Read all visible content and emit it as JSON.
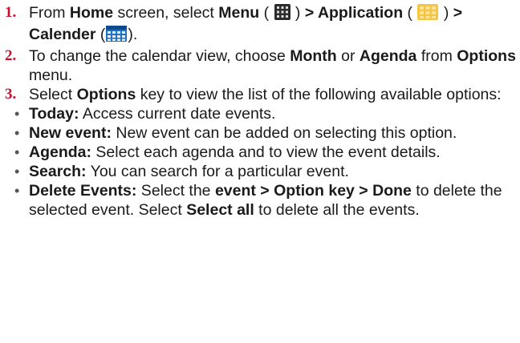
{
  "steps": [
    {
      "number": "1.",
      "parts": {
        "t1": "From ",
        "b1": "Home",
        "t2": " screen, select ",
        "b2": "Menu",
        "t3": " ( ",
        "t4": " ) ",
        "b3": "> Application",
        "t5": " ( ",
        "t6": " ) ",
        "b4": "> Calender",
        "t7": " (",
        "t8": ")."
      }
    },
    {
      "number": "2.",
      "parts": {
        "t1": "To change the calendar view, choose ",
        "b1": "Month",
        "t2": " or ",
        "b2": "Agenda",
        "t3": " from ",
        "b3": "Options",
        "t4": " menu."
      }
    },
    {
      "number": "3.",
      "parts": {
        "t1": "Select ",
        "b1": "Options",
        "t2": " key to view the list of the following available options:"
      }
    }
  ],
  "options": [
    {
      "term": "Today:",
      "desc": " Access current date events."
    },
    {
      "term": "New event:",
      "desc": " New event can be added on selecting this option."
    },
    {
      "term": "Agenda:",
      "desc": " Select each agenda and to view the event details."
    },
    {
      "term": "Search:",
      "desc": " You can search for a particular event."
    }
  ],
  "delete_option": {
    "term": "Delete Events:",
    "t1": " Select the ",
    "b1": "event > Option key > Done",
    "t2": " to delete the selected event. Select ",
    "b2": "Select all",
    "t3": " to delete all the events."
  },
  "icons": {
    "menu": "menu-grid-icon",
    "application": "application-folder-icon",
    "calendar": "calendar-icon"
  },
  "colors": {
    "step_number": "#c8102e",
    "menu_icon": "#2b2b2b",
    "application_icon": "#f5c542",
    "calendar_icon": "#1f6fc5"
  }
}
